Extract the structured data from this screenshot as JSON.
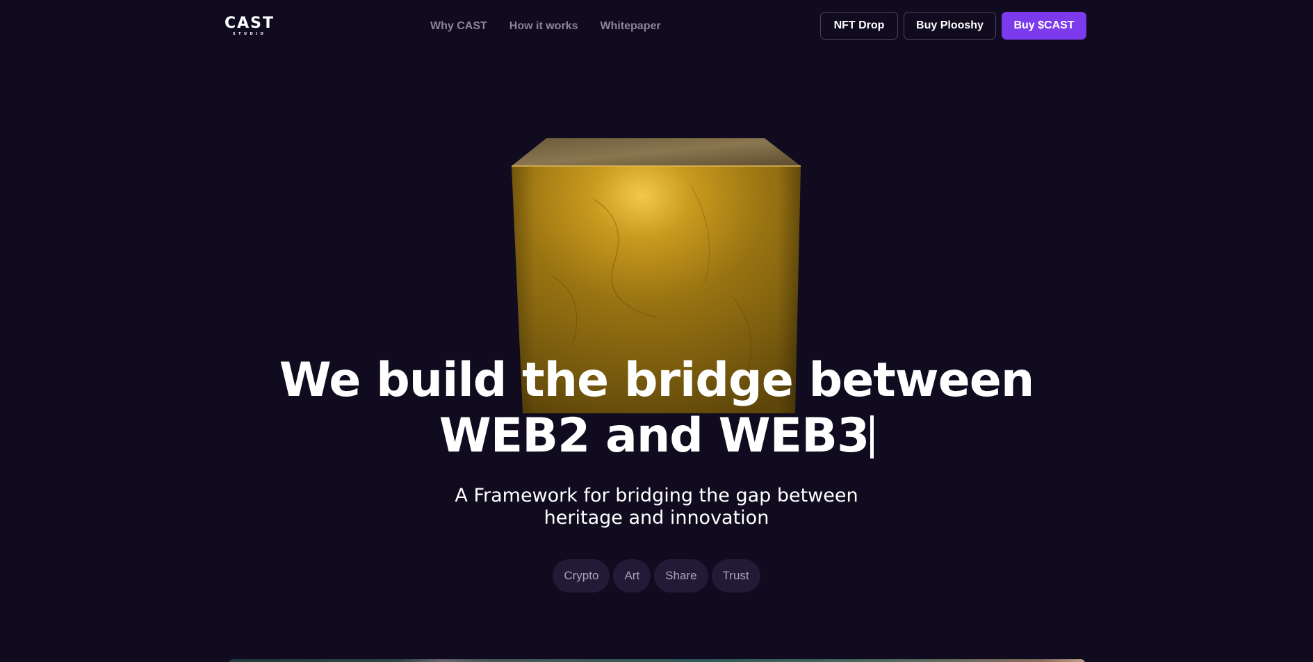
{
  "header": {
    "logo": {
      "main": "CAST",
      "sub": "STUDIO"
    },
    "nav": [
      {
        "label": "Why CAST"
      },
      {
        "label": "How it works"
      },
      {
        "label": "Whitepaper"
      }
    ],
    "buttons": {
      "nft_drop": "NFT Drop",
      "buy_plooshy": "Buy Plooshy",
      "buy_cast": "Buy $CAST"
    }
  },
  "hero": {
    "headline_line1": "We build the bridge between",
    "headline_line2": "WEB2 and WEB3",
    "subtitle_line1": "A Framework for bridging the gap between",
    "subtitle_line2": "heritage and innovation",
    "tags": [
      "Crypto",
      "Art",
      "Share",
      "Trust"
    ]
  },
  "colors": {
    "background": "#110b1f",
    "accent": "#7c3aed",
    "nav_text": "#8a8598",
    "tag_bg": "#221a36",
    "gold": "#b8860b"
  },
  "icons": {
    "hero_visual": "gold-cube"
  }
}
